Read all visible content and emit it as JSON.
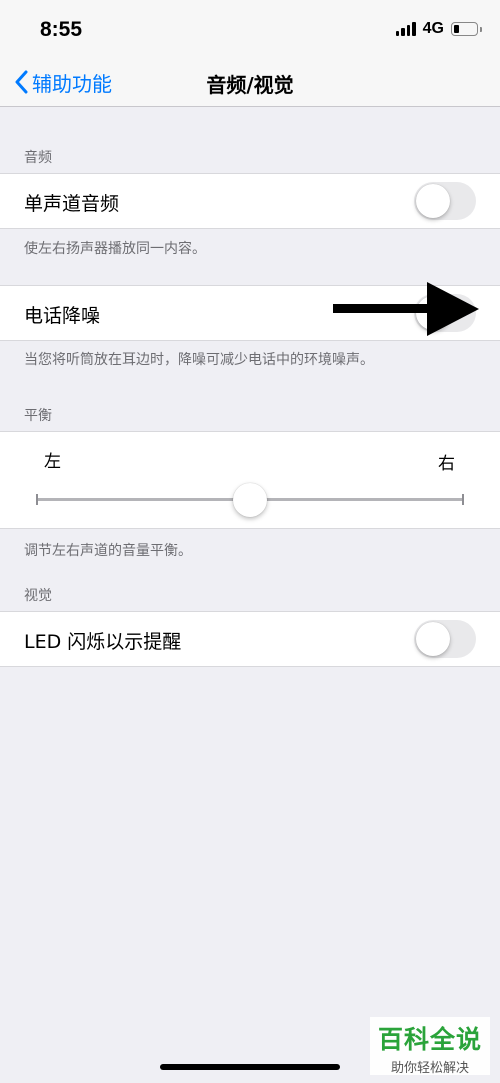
{
  "status_bar": {
    "time": "8:55",
    "network": "4G",
    "signal_bars": 4,
    "battery_level_fraction": 0.25
  },
  "nav": {
    "back_label": "辅助功能",
    "back_icon": "chevron-left-icon",
    "title": "音频/视觉"
  },
  "audio_section": {
    "header": "音频",
    "mono_audio": {
      "label": "单声道音频",
      "enabled": false
    },
    "mono_audio_footer": "使左右扬声器播放同一内容。",
    "phone_noise_cancellation": {
      "label": "电话降噪",
      "enabled": false
    },
    "noise_footer": "当您将听筒放在耳边时，降噪可减少电话中的环境噪声。"
  },
  "balance_section": {
    "header": "平衡",
    "left_label": "左",
    "right_label": "右",
    "balance_value_fraction": 0.5,
    "footer": "调节左右声道的音量平衡。"
  },
  "visual_section": {
    "header": "视觉",
    "led_flash": {
      "label": "LED 闪烁以示提醒",
      "enabled": false
    }
  },
  "watermark": {
    "title": "百科全说",
    "subtitle": "助你轻松解决"
  },
  "colors": {
    "accent": "#007aff",
    "background": "#efeff4",
    "toggle_off": "#e9e9eb",
    "watermark_green": "#2aa33a"
  }
}
